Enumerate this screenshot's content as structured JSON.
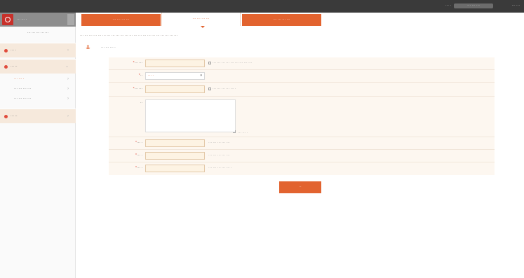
{
  "topbar": {
    "user_label": "··· ·",
    "user_name": "··· ··· ···",
    "logout": "··· ···"
  },
  "sidebar": {
    "title": "··· ··· ·",
    "subtitle": "··· ··· ··· ··· ···",
    "menus": [
      {
        "label": "··· ·",
        "icon": "red-dot-icon"
      },
      {
        "label": "··· ··",
        "icon": "red-dot-icon"
      },
      {
        "label": "··· ··",
        "icon": "red-dot-icon"
      }
    ],
    "submenus": [
      {
        "label": "··· ··· ·",
        "active": true
      },
      {
        "label": "··· ··· ··· ···",
        "active": false
      },
      {
        "label": "··· ··· ··· ···",
        "active": false
      }
    ]
  },
  "tabs": [
    {
      "label": "··· ··· ··· ···",
      "active": false
    },
    {
      "label": "··· ··· ··· ···",
      "active": true
    },
    {
      "label": "··· ··· ··· ···",
      "active": false
    }
  ],
  "notice": "··· ··· ··· ··· ··· ··· ··· ··· ··· ··· ··· ··· ··· ··· ··· ··· ··· ··· ··· ··· ··· ···",
  "section": {
    "title": "··· ··· ··· ·",
    "icon": "arrow-down-icon"
  },
  "form": {
    "rows": [
      {
        "label": "··· ···",
        "required": true,
        "hint": "··· ··· ··· ··· ··· ··· ··· ··· ···",
        "value": ""
      },
      {
        "label": "··",
        "required": true,
        "selected": "··· ·",
        "hint": ""
      },
      {
        "label": "··· ···",
        "required": true,
        "hint": "··· ··· ··· ··· ··· ·",
        "value": ""
      },
      {
        "label": "··",
        "required": false,
        "textarea_value": "",
        "count": "··· ··· ·"
      },
      {
        "label": "··· ·",
        "required": true,
        "hint": "··· ··· ··· ··· ···",
        "value": ""
      },
      {
        "label": "··· ·",
        "required": true,
        "hint": "··· ··· ··· ··· ···",
        "value": ""
      },
      {
        "label": "··· ·",
        "required": true,
        "hint": "··· ··· ··· ··· ··· ·",
        "value": ""
      }
    ]
  },
  "submit_label": "··",
  "colors": {
    "accent": "#e2632f",
    "topbar": "#3a3a3a",
    "menu_bg": "#f6e9dc",
    "form_bg": "#fdf7f0",
    "input_bg": "#fdf3e3",
    "required": "#e04b3c"
  }
}
